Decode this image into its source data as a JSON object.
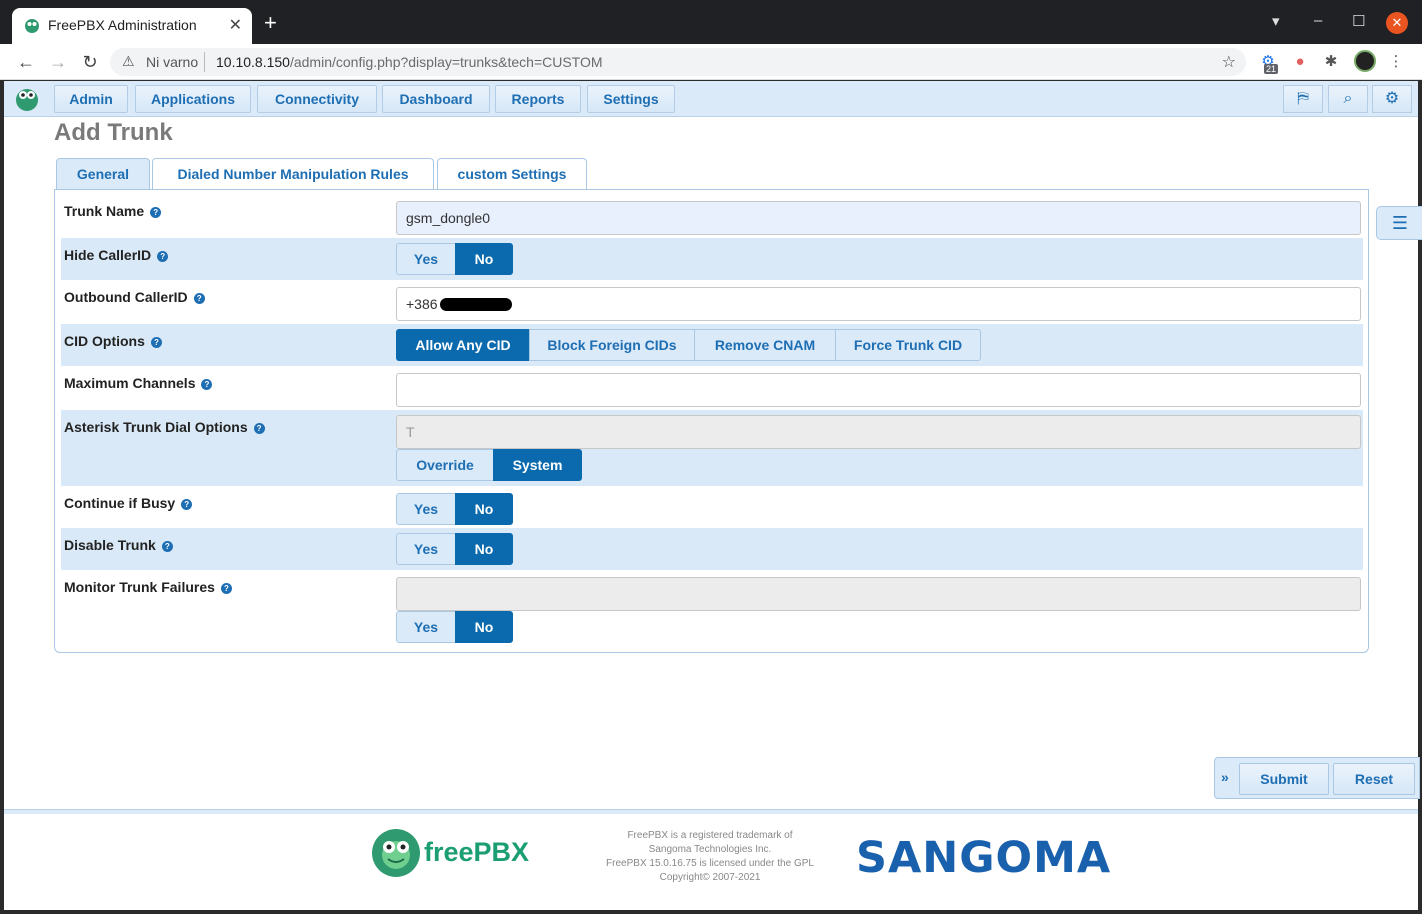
{
  "browser": {
    "tab_title": "FreePBX Administration",
    "tab_close": "✕",
    "new_tab": "+",
    "window_controls": [
      "▾",
      "–",
      "☐",
      "✕"
    ],
    "security_label": "Ni varno",
    "url_host": "10.10.8.150",
    "url_path": "/admin/config.php?display=trunks&tech=CUSTOM",
    "ext_badge": "21"
  },
  "menu": {
    "items": [
      "Admin",
      "Applications",
      "Connectivity",
      "Dashboard",
      "Reports",
      "Settings"
    ]
  },
  "page": {
    "title": "Add Trunk",
    "tabs": [
      "General",
      "Dialed Number Manipulation Rules",
      "custom Settings"
    ]
  },
  "form": {
    "trunk_name": {
      "label": "Trunk Name",
      "value": "gsm_dongle0"
    },
    "hide_callerid": {
      "label": "Hide CallerID",
      "options": [
        "Yes",
        "No"
      ],
      "selected": "No"
    },
    "outbound_callerid": {
      "label": "Outbound CallerID",
      "value": "+386"
    },
    "cid_options": {
      "label": "CID Options",
      "options": [
        "Allow Any CID",
        "Block Foreign CIDs",
        "Remove CNAM",
        "Force Trunk CID"
      ],
      "selected": "Allow Any CID"
    },
    "max_channels": {
      "label": "Maximum Channels",
      "value": ""
    },
    "dial_options": {
      "label": "Asterisk Trunk Dial Options",
      "value": "T",
      "options": [
        "Override",
        "System"
      ],
      "selected": "System"
    },
    "continue_if_busy": {
      "label": "Continue if Busy",
      "options": [
        "Yes",
        "No"
      ],
      "selected": "No"
    },
    "disable_trunk": {
      "label": "Disable Trunk",
      "options": [
        "Yes",
        "No"
      ],
      "selected": "No"
    },
    "monitor_failures": {
      "label": "Monitor Trunk Failures",
      "value": "",
      "options": [
        "Yes",
        "No"
      ],
      "selected": "No"
    }
  },
  "actions": {
    "submit": "Submit",
    "reset": "Reset",
    "expand": "»"
  },
  "footer": {
    "freepbx_logo_text": "freePBX",
    "legal_lines": [
      "FreePBX is a registered trademark of",
      "Sangoma Technologies Inc.",
      "FreePBX 15.0.16.75 is licensed under the GPL",
      "Copyright© 2007-2021"
    ],
    "sangoma_logo_text": "SANGOMA"
  },
  "colors": {
    "accent": "#1e6eb3",
    "selected": "#0b6aad",
    "row_shade": "#d9e9f7",
    "sangoma_orange": "#f06d22"
  }
}
